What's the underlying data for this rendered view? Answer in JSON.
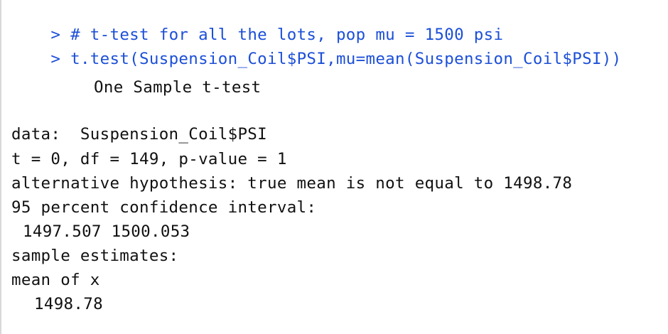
{
  "console": {
    "prompt": ">",
    "commands": [
      "# t-test for all the lots, pop mu = 1500 psi",
      "t.test(Suspension_Coil$PSI,mu=mean(Suspension_Coil$PSI))"
    ],
    "output": {
      "test_title": "One Sample t-test",
      "data_line": "data:  Suspension_Coil$PSI",
      "stats_line": "t = 0, df = 149, p-value = 1",
      "alt_hypothesis_line": "alternative hypothesis: true mean is not equal to 1498.78",
      "ci_header": "95 percent confidence interval:",
      "ci_values": "1497.507 1500.053",
      "estimates_header": "sample estimates:",
      "estimate_label": "mean of x",
      "estimate_value": "1498.78"
    }
  },
  "colors": {
    "command": "#1c4fd8",
    "output": "#111111",
    "background": "#ffffff"
  }
}
